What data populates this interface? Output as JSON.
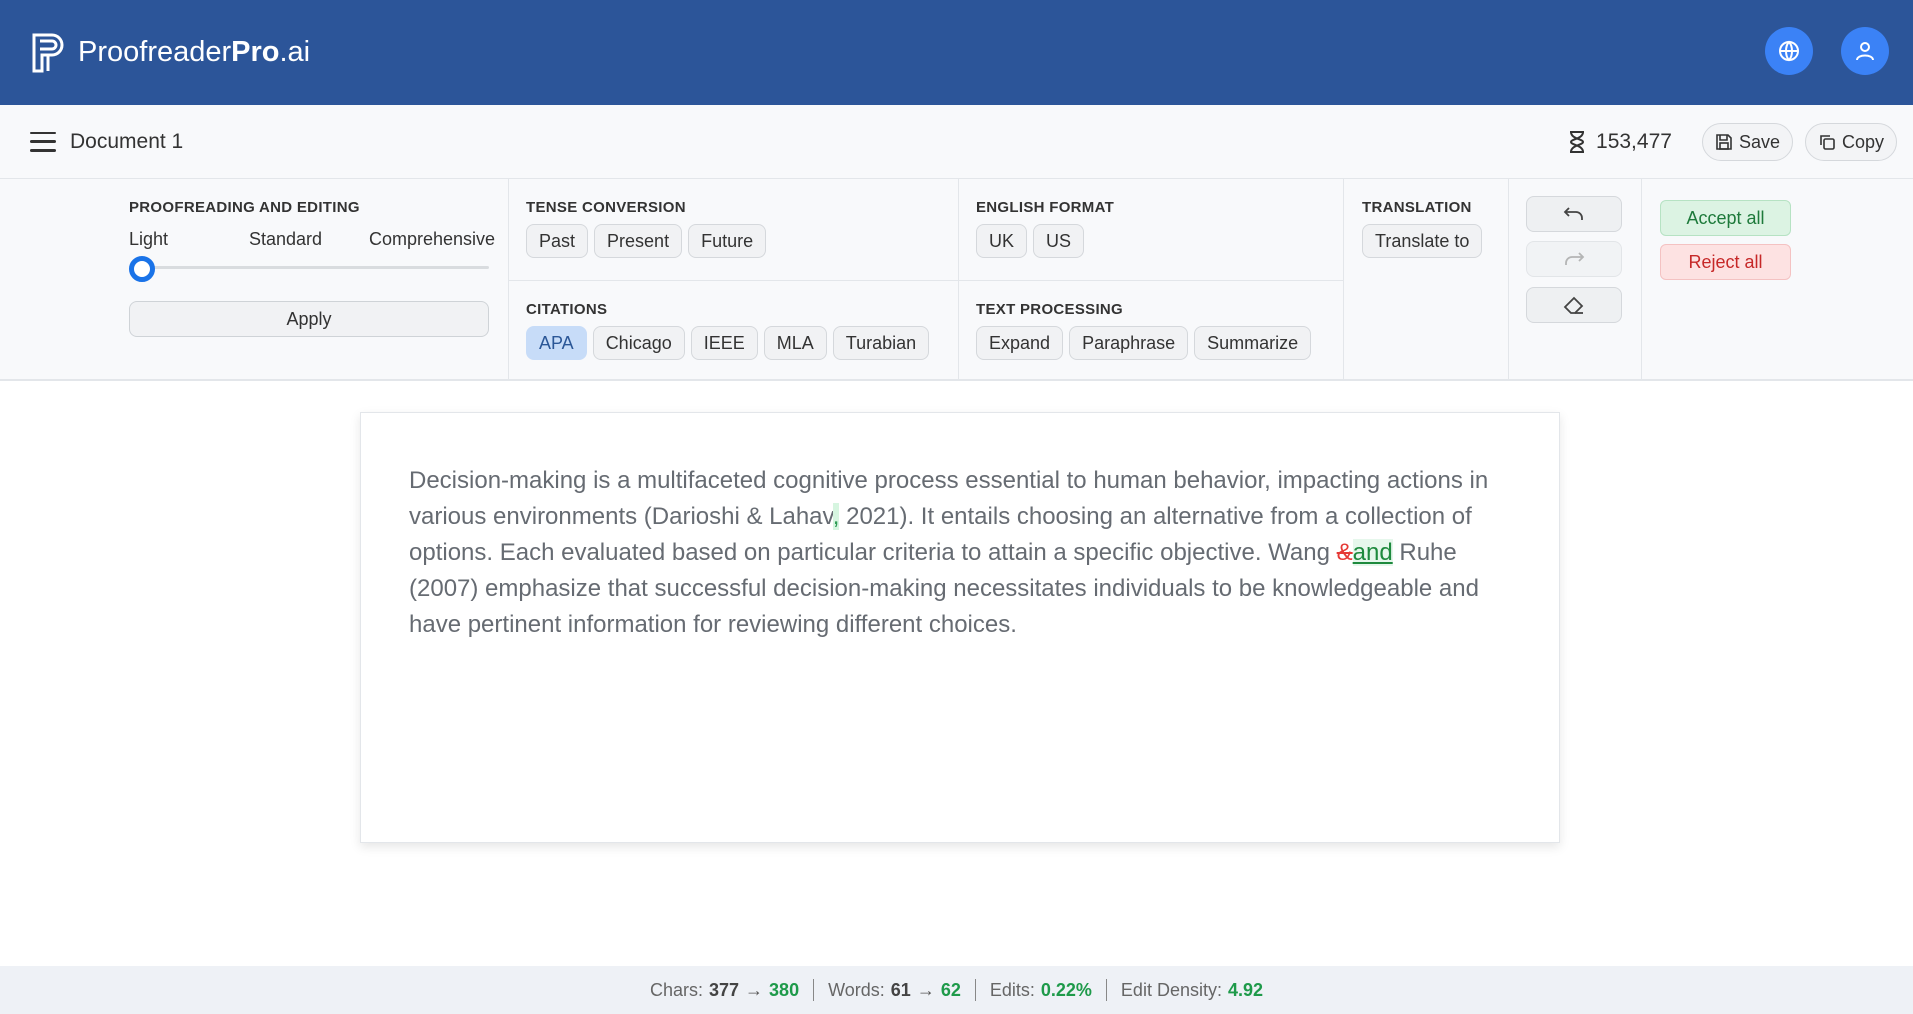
{
  "header": {
    "logo_part1": "Proofreader",
    "logo_part2": "Pro",
    "logo_part3": ".ai",
    "globe_icon": "globe-icon",
    "user_icon": "user-icon"
  },
  "docbar": {
    "title": "Document 1",
    "credits": "153,477",
    "save_label": "Save",
    "copy_label": "Copy"
  },
  "toolbar": {
    "proofreading": {
      "title": "PROOFREADING AND EDITING",
      "levels": [
        "Light",
        "Standard",
        "Comprehensive"
      ],
      "selected_level": "Light",
      "apply_label": "Apply"
    },
    "tense": {
      "title": "TENSE CONVERSION",
      "options": [
        "Past",
        "Present",
        "Future"
      ]
    },
    "citations": {
      "title": "CITATIONS",
      "options": [
        "APA",
        "Chicago",
        "IEEE",
        "MLA",
        "Turabian"
      ],
      "selected": "APA"
    },
    "english_format": {
      "title": "ENGLISH FORMAT",
      "options": [
        "UK",
        "US"
      ]
    },
    "text_processing": {
      "title": "TEXT PROCESSING",
      "options": [
        "Expand",
        "Paraphrase",
        "Summarize"
      ]
    },
    "translation": {
      "title": "TRANSLATION",
      "translate_label": "Translate to"
    },
    "accept_all_label": "Accept all",
    "reject_all_label": "Reject all"
  },
  "editor": {
    "seg1": "Decision-making is a multifaceted cognitive process essential to human behavior, impacting actions in various environments (Darioshi & Lahav",
    "ins_comma": ",",
    "seg2": " 2021). It entails choosing an alternative from a collection of options. Each evaluated based on particular criteria to attain a specific objective. Wang ",
    "deleted": "&",
    "inserted": "and",
    "seg3": " Ruhe (2007) emphasize that successful decision-making necessitates individuals to be knowledgeable and have pertinent information for reviewing different choices."
  },
  "status": {
    "chars_label": "Chars:",
    "chars_before": "377",
    "chars_after": "380",
    "words_label": "Words:",
    "words_before": "61",
    "words_after": "62",
    "edits_label": "Edits:",
    "edits_value": "0.22%",
    "density_label": "Edit Density:",
    "density_value": "4.92"
  },
  "colors": {
    "header_bg": "#2c5599",
    "accent": "#3b82f6",
    "insert_green": "#1e8a3e",
    "delete_red": "#e53935"
  }
}
